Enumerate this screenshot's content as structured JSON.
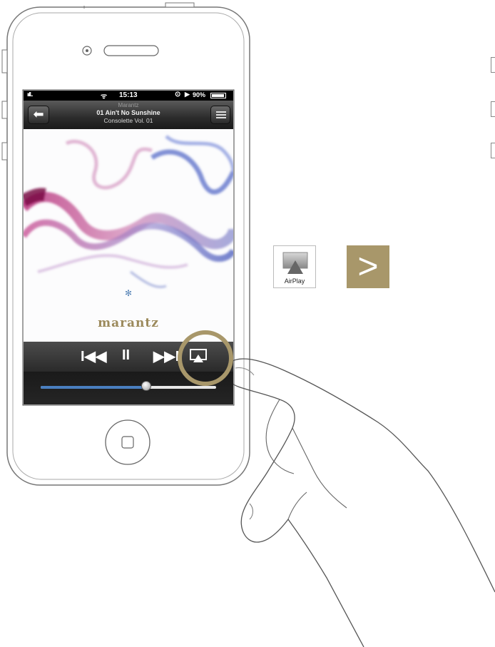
{
  "status_bar": {
    "signal": "ııll..",
    "wifi_icon": "wifi-icon",
    "time": "15:13",
    "lock_icon": "rotation-lock-icon",
    "play_icon": "play-indicator-icon",
    "battery": "90%"
  },
  "header": {
    "source": "Marantz",
    "track": "01 Ain't No Sunshine",
    "album": "Consolette Vol. 01",
    "back_icon": "back-arrow-icon",
    "list_icon": "list-icon"
  },
  "album_art": {
    "brand_text": "marantz"
  },
  "controls": {
    "previous": "I◀◀",
    "pause": "II",
    "next": "▶▶I",
    "airplay_icon": "airplay-icon"
  },
  "scrubber": {
    "progress": 0.6
  },
  "side_panel": {
    "airplay_tile_label": "AirPlay",
    "next_step_symbol": ">"
  },
  "colors": {
    "accent_gold": "#a8976a",
    "highlight_ring": "#a8976a",
    "progress_blue": "#4a7fc0"
  }
}
